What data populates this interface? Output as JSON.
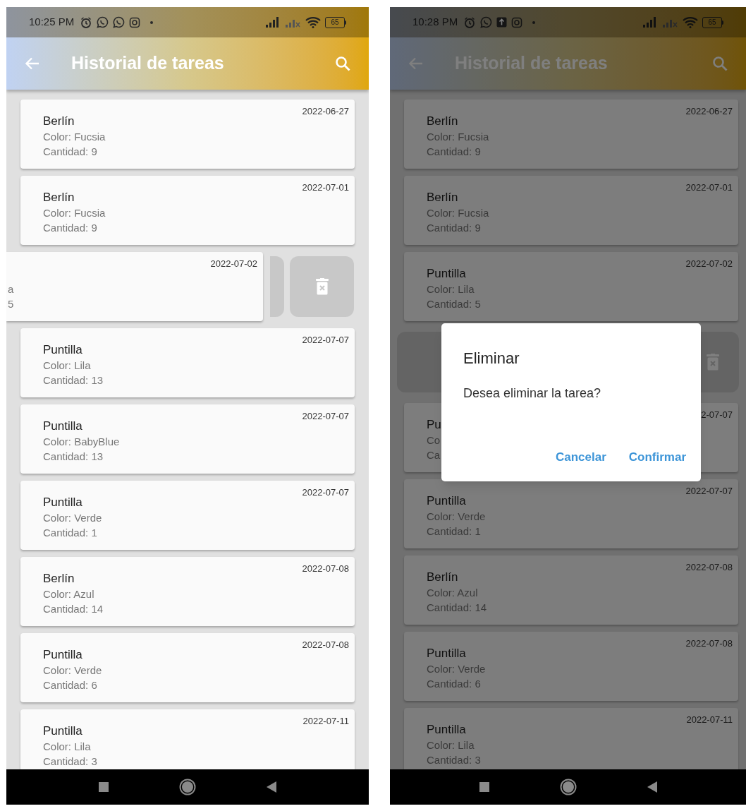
{
  "screens": [
    {
      "status_bar": {
        "time": "10:25 PM",
        "notification_icons": [
          {
            "kind": "alarm"
          },
          {
            "kind": "chat"
          },
          {
            "kind": "chat"
          },
          {
            "kind": "camera"
          },
          {
            "kind": "dot"
          }
        ],
        "battery": "65"
      },
      "app_bar": {
        "title": "Historial de tareas"
      },
      "dimmed": false,
      "items": [
        {
          "kind": "card",
          "name": "Berlín",
          "color_line": "Color: Fucsia",
          "quantity": "Cantidad: 9",
          "date": "2022-06-27"
        },
        {
          "kind": "card",
          "name": "Berlín",
          "color_line": "Color: Fucsia",
          "quantity": "Cantidad: 9",
          "date": "2022-07-01"
        },
        {
          "kind": "swiped",
          "color_line": "a",
          "quantity": "5",
          "date": "2022-07-02"
        },
        {
          "kind": "card",
          "name": "Puntilla",
          "color_line": "Color: Lila",
          "quantity": "Cantidad: 13",
          "date": "2022-07-07"
        },
        {
          "kind": "card",
          "name": "Puntilla",
          "color_line": "Color: BabyBlue",
          "quantity": "Cantidad: 13",
          "date": "2022-07-07"
        },
        {
          "kind": "card",
          "name": "Puntilla",
          "color_line": "Color: Verde",
          "quantity": "Cantidad: 1",
          "date": "2022-07-07"
        },
        {
          "kind": "card",
          "name": "Berlín",
          "color_line": "Color: Azul",
          "quantity": "Cantidad: 14",
          "date": "2022-07-08"
        },
        {
          "kind": "card",
          "name": "Puntilla",
          "color_line": "Color: Verde",
          "quantity": "Cantidad: 6",
          "date": "2022-07-08"
        },
        {
          "kind": "card",
          "name": "Puntilla",
          "color_line": "Color: Lila",
          "quantity": "Cantidad: 3",
          "date": "2022-07-11"
        }
      ]
    },
    {
      "status_bar": {
        "time": "10:28 PM",
        "notification_icons": [
          {
            "kind": "alarm"
          },
          {
            "kind": "chat"
          },
          {
            "kind": "upload"
          },
          {
            "kind": "camera"
          },
          {
            "kind": "dot"
          }
        ],
        "battery": "65"
      },
      "app_bar": {
        "title": "Historial de tareas"
      },
      "dimmed": true,
      "items": [
        {
          "kind": "card",
          "name": "Berlín",
          "color_line": "Color: Fucsia",
          "quantity": "Cantidad: 9",
          "date": "2022-06-27"
        },
        {
          "kind": "card",
          "name": "Berlín",
          "color_line": "Color: Fucsia",
          "quantity": "Cantidad: 9",
          "date": "2022-07-01"
        },
        {
          "kind": "card",
          "name": "Puntilla",
          "color_line": "Color: Lila",
          "quantity": "Cantidad: 5",
          "date": "2022-07-02"
        },
        {
          "kind": "dismissed"
        },
        {
          "kind": "card",
          "name": "Pu",
          "color_line": "Co",
          "quantity": "Ca",
          "date": "2-07-07"
        },
        {
          "kind": "card",
          "name": "Puntilla",
          "color_line": "Color: Verde",
          "quantity": "Cantidad: 1",
          "date": "2022-07-07"
        },
        {
          "kind": "card",
          "name": "Berlín",
          "color_line": "Color: Azul",
          "quantity": "Cantidad: 14",
          "date": "2022-07-08"
        },
        {
          "kind": "card",
          "name": "Puntilla",
          "color_line": "Color: Verde",
          "quantity": "Cantidad: 6",
          "date": "2022-07-08"
        },
        {
          "kind": "card",
          "name": "Puntilla",
          "color_line": "Color: Lila",
          "quantity": "Cantidad: 3",
          "date": "2022-07-11"
        }
      ],
      "dialog": {
        "title": "Eliminar",
        "message": "Desea eliminar la tarea?",
        "buttons": [
          "Cancelar",
          "Confirmar"
        ]
      }
    }
  ]
}
